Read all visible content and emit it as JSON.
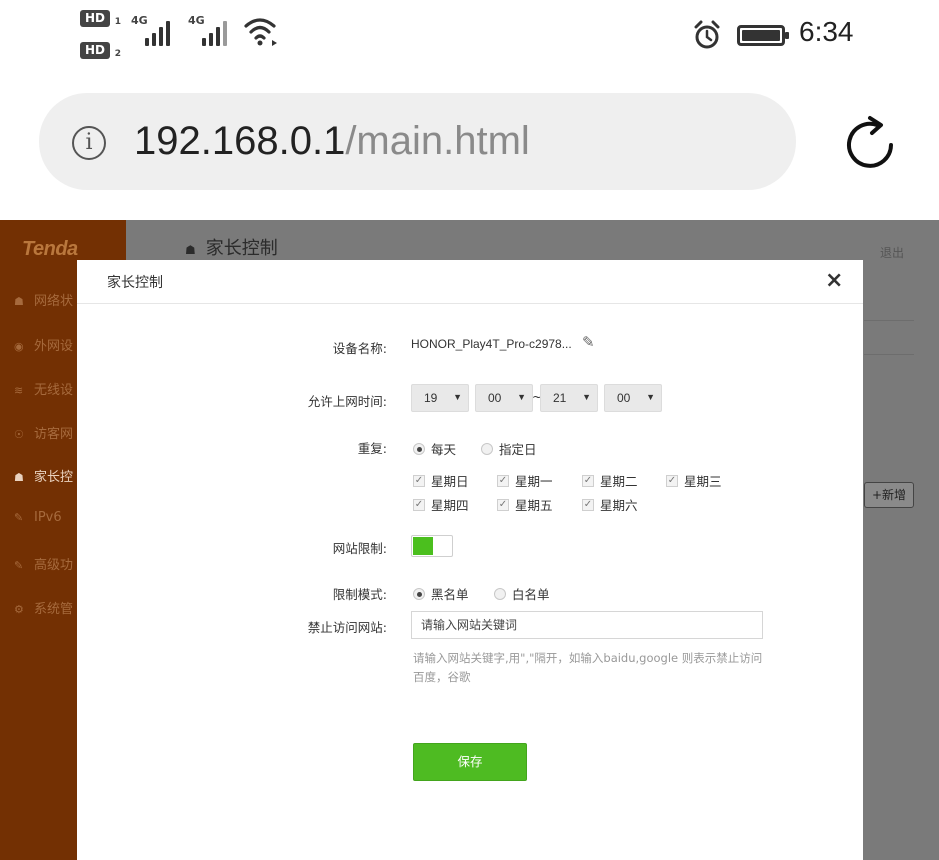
{
  "status_bar": {
    "hd1": "HD",
    "hd1_sub": "1",
    "hd2": "HD",
    "hd2_sub": "2",
    "signal1": "4G",
    "signal2": "4G",
    "time": "6:34"
  },
  "url_bar": {
    "host": "192.168.0.1",
    "path": "/main.html"
  },
  "sidebar": {
    "logo": "Tenda",
    "items": [
      {
        "icon": "☗",
        "label": "网络状"
      },
      {
        "icon": "◉",
        "label": "外网设"
      },
      {
        "icon": "≋",
        "label": "无线设"
      },
      {
        "icon": "☉",
        "label": "访客网"
      },
      {
        "icon": "☗",
        "label": "家长控"
      },
      {
        "icon": "✎",
        "label": "IPv6"
      },
      {
        "icon": "✎",
        "label": "高级功"
      },
      {
        "icon": "⚙",
        "label": "系统管"
      }
    ]
  },
  "background_page": {
    "title": "家长控制",
    "logout": "退出",
    "add_button": "+新增"
  },
  "modal": {
    "title": "家长控制",
    "close": "×",
    "device_label": "设备名称:",
    "device_name": "HONOR_Play4T_Pro-c2978...",
    "time_label": "允许上网时间:",
    "time": {
      "start_hour": "19",
      "start_minute": "00",
      "separator": "~",
      "end_hour": "21",
      "end_minute": "00"
    },
    "repeat_label": "重复:",
    "repeat_options": [
      "每天",
      "指定日"
    ],
    "repeat_selected": "每天",
    "weekdays": [
      "星期日",
      "星期一",
      "星期二",
      "星期三",
      "星期四",
      "星期五",
      "星期六"
    ],
    "site_limit_label": "网站限制:",
    "site_limit_enabled": true,
    "limit_mode_label": "限制模式:",
    "limit_mode_options": [
      "黑名单",
      "白名单"
    ],
    "limit_mode_selected": "黑名单",
    "blocked_sites_label": "禁止访问网站:",
    "keyword_placeholder": "请输入网站关键词",
    "hint": "请输入网站关键字,用\",\"隔开，如输入baidu,google 则表示禁止访问百度，谷歌",
    "save": "保存"
  },
  "colors": {
    "sidebar": "#733003",
    "overlay": "#7b7b7b",
    "accent_green": "#4ebb22"
  }
}
